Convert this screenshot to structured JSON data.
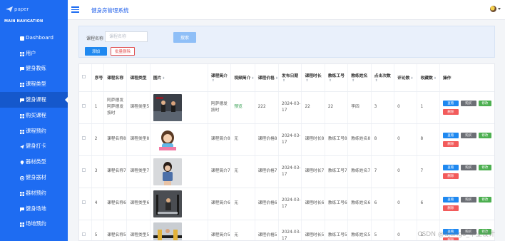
{
  "sidebar": {
    "logo_text": "paper",
    "main_nav_label": "MAIN NAVIGATION",
    "items": [
      {
        "label": "Dashboard",
        "icon": "dashboard-icon"
      },
      {
        "label": "用户",
        "icon": "grid-icon"
      },
      {
        "label": "健身教练",
        "icon": "chat-icon"
      },
      {
        "label": "课程类型",
        "icon": "grid-icon"
      },
      {
        "label": "健身课程",
        "icon": "chat-icon"
      },
      {
        "label": "购买课程",
        "icon": "grid-icon"
      },
      {
        "label": "课程预约",
        "icon": "grid-icon"
      },
      {
        "label": "健身打卡",
        "icon": "send-icon"
      },
      {
        "label": "器材类型",
        "icon": "pin-icon"
      },
      {
        "label": "健身器材",
        "icon": "target-icon"
      },
      {
        "label": "器材预约",
        "icon": "grid-icon"
      },
      {
        "label": "健身场地",
        "icon": "chat-icon"
      },
      {
        "label": "场地预约",
        "icon": "grid-icon"
      }
    ],
    "active_index": 4,
    "colors": {
      "background": "#1e6cf2",
      "active": "#1558cc"
    }
  },
  "header": {
    "title": "健身房管理系统"
  },
  "search": {
    "label": "课程名称",
    "placeholder": "课程名称",
    "button": "搜索",
    "add_button": "添加",
    "bulk_delete_button": "批量删除"
  },
  "table": {
    "columns": [
      "",
      "序号",
      "课程名称",
      "课程类型",
      "图片",
      "课程简介",
      "视频简介",
      "课程价格",
      "发布日期",
      "课程时长",
      "教练工号",
      "教练姓名",
      "点击次数",
      "评论数",
      "收藏数",
      "操作"
    ],
    "rows": [
      {
        "no": "1",
        "name": "阿萨德发阿萨德发按时",
        "type": "课程类型5",
        "image": "gym-photo",
        "intro": "阿萨德发按时",
        "video": "预览",
        "price": "222",
        "date": "2024-03-17",
        "duration": "22",
        "coach_id": "22",
        "coach_name": "李四",
        "clicks": "3",
        "comments": "0",
        "favorites": "1"
      },
      {
        "no": "2",
        "name": "课程名称8",
        "type": "课程类型8",
        "image": "cartoon-trainer",
        "intro": "课程简介8",
        "video": "无",
        "price": "课程价格8",
        "date": "2024-03-17",
        "duration": "课程时长8",
        "coach_id": "教练工号8",
        "coach_name": "教练姓名8",
        "clicks": "8",
        "comments": "0",
        "favorites": "8"
      },
      {
        "no": "3",
        "name": "课程名称7",
        "type": "课程类型7",
        "image": "yoga-woman",
        "intro": "课程简介7",
        "video": "无",
        "price": "课程价格7",
        "date": "2024-03-17",
        "duration": "课程时长7",
        "coach_id": "教练工号7",
        "coach_name": "教练姓名7",
        "clicks": "7",
        "comments": "0",
        "favorites": "7"
      },
      {
        "no": "4",
        "name": "课程名称6",
        "type": "课程类型6",
        "image": "gym-machine",
        "intro": "课程简介6",
        "video": "无",
        "price": "课程价格6",
        "date": "2024-03-17",
        "duration": "课程时长6",
        "coach_id": "教练工号6",
        "coach_name": "教练姓名6",
        "clicks": "6",
        "comments": "0",
        "favorites": "6"
      },
      {
        "no": "5",
        "name": "课程名称5",
        "type": "课程类型5",
        "image": "weights-photo",
        "intro": "课程简介5",
        "video": "无",
        "price": "课程价格5",
        "date": "2024-03-17",
        "duration": "课程时长5",
        "coach_id": "教练工号5",
        "coach_name": "教练姓名5",
        "clicks": "5",
        "comments": "0",
        "favorites": "5"
      }
    ],
    "actions": {
      "view": "查看",
      "buy": "购买",
      "edit": "修改",
      "delete": "删除"
    }
  },
  "watermark": "CSDN @django_毕业设计"
}
